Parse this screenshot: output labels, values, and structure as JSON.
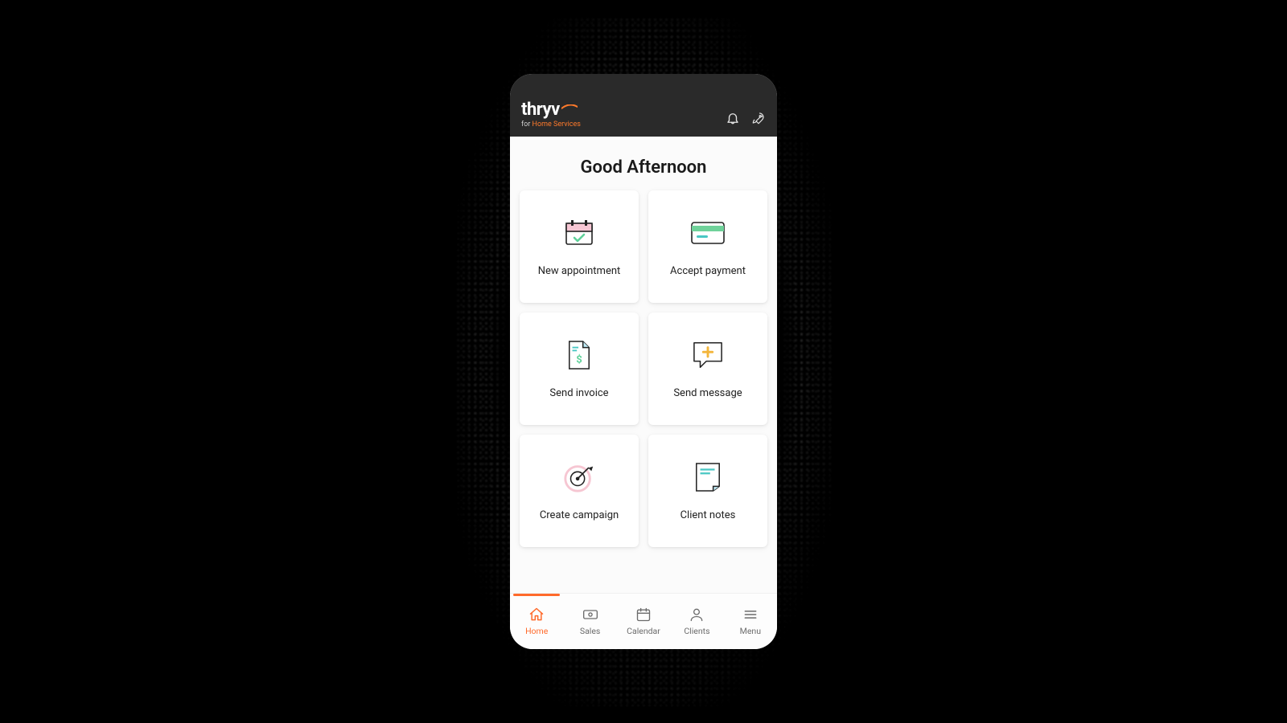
{
  "brand": {
    "name": "thryv",
    "subline_prefix": "for ",
    "subline_suffix": "Home Services"
  },
  "header": {
    "icons": [
      "bell-icon",
      "rocket-icon"
    ]
  },
  "greeting": "Good Afternoon",
  "cards": [
    {
      "id": "new-appointment",
      "label": "New appointment",
      "icon": "calendar-check-icon"
    },
    {
      "id": "accept-payment",
      "label": "Accept payment",
      "icon": "credit-card-icon"
    },
    {
      "id": "send-invoice",
      "label": "Send invoice",
      "icon": "invoice-icon"
    },
    {
      "id": "send-message",
      "label": "Send message",
      "icon": "message-plus-icon"
    },
    {
      "id": "create-campaign",
      "label": "Create campaign",
      "icon": "target-arrow-icon"
    },
    {
      "id": "client-notes",
      "label": "Client notes",
      "icon": "notes-page-icon"
    }
  ],
  "tabs": [
    {
      "id": "home",
      "label": "Home",
      "icon": "home-icon",
      "active": true
    },
    {
      "id": "sales",
      "label": "Sales",
      "icon": "money-icon",
      "active": false
    },
    {
      "id": "calendar",
      "label": "Calendar",
      "icon": "calendar-icon",
      "active": false
    },
    {
      "id": "clients",
      "label": "Clients",
      "icon": "person-icon",
      "active": false
    },
    {
      "id": "menu",
      "label": "Menu",
      "icon": "menu-icon",
      "active": false
    }
  ],
  "colors": {
    "accent": "#ff6a2b",
    "header_bg": "#2a2a2a",
    "card_bg": "#ffffff",
    "page_bg": "#fbfbfb"
  }
}
